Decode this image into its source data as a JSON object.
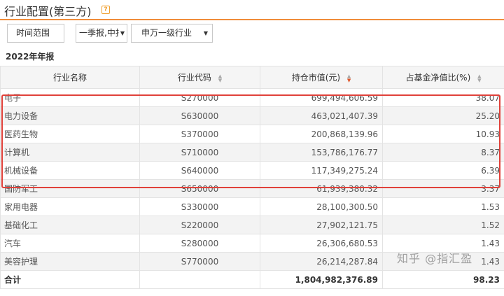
{
  "header": {
    "title": "行业配置(第三方)",
    "help_icon": "question-mark-icon"
  },
  "filters": {
    "time_range": "时间范围",
    "period": "一季报,中报",
    "industry": "申万一级行业"
  },
  "table": {
    "year_label": "2022年年报",
    "columns": [
      "行业名称",
      "行业代码",
      "持仓市值(元)",
      "占基金净值比(%)"
    ],
    "rows": [
      {
        "name": "电子",
        "code": "S270000",
        "value": "699,494,606.59",
        "pct": "38.07"
      },
      {
        "name": "电力设备",
        "code": "S630000",
        "value": "463,021,407.39",
        "pct": "25.20"
      },
      {
        "name": "医药生物",
        "code": "S370000",
        "value": "200,868,139.96",
        "pct": "10.93"
      },
      {
        "name": "计算机",
        "code": "S710000",
        "value": "153,786,176.77",
        "pct": "8.37"
      },
      {
        "name": "机械设备",
        "code": "S640000",
        "value": "117,349,275.24",
        "pct": "6.39"
      },
      {
        "name": "国防军工",
        "code": "S650000",
        "value": "61,939,380.32",
        "pct": "3.37"
      },
      {
        "name": "家用电器",
        "code": "S330000",
        "value": "28,100,300.50",
        "pct": "1.53"
      },
      {
        "name": "基础化工",
        "code": "S220000",
        "value": "27,902,121.75",
        "pct": "1.52"
      },
      {
        "name": "汽车",
        "code": "S280000",
        "value": "26,306,680.53",
        "pct": "1.43"
      },
      {
        "name": "美容护理",
        "code": "S770000",
        "value": "26,214,287.84",
        "pct": "1.43"
      }
    ],
    "total": {
      "name": "合计",
      "code": "",
      "value": "1,804,982,376.89",
      "pct": "98.23"
    }
  },
  "watermark": "知乎 @指汇盈",
  "colors": {
    "accent": "#f08c3a",
    "highlight_box": "#e0413a",
    "sort_active": "#e0562a"
  }
}
